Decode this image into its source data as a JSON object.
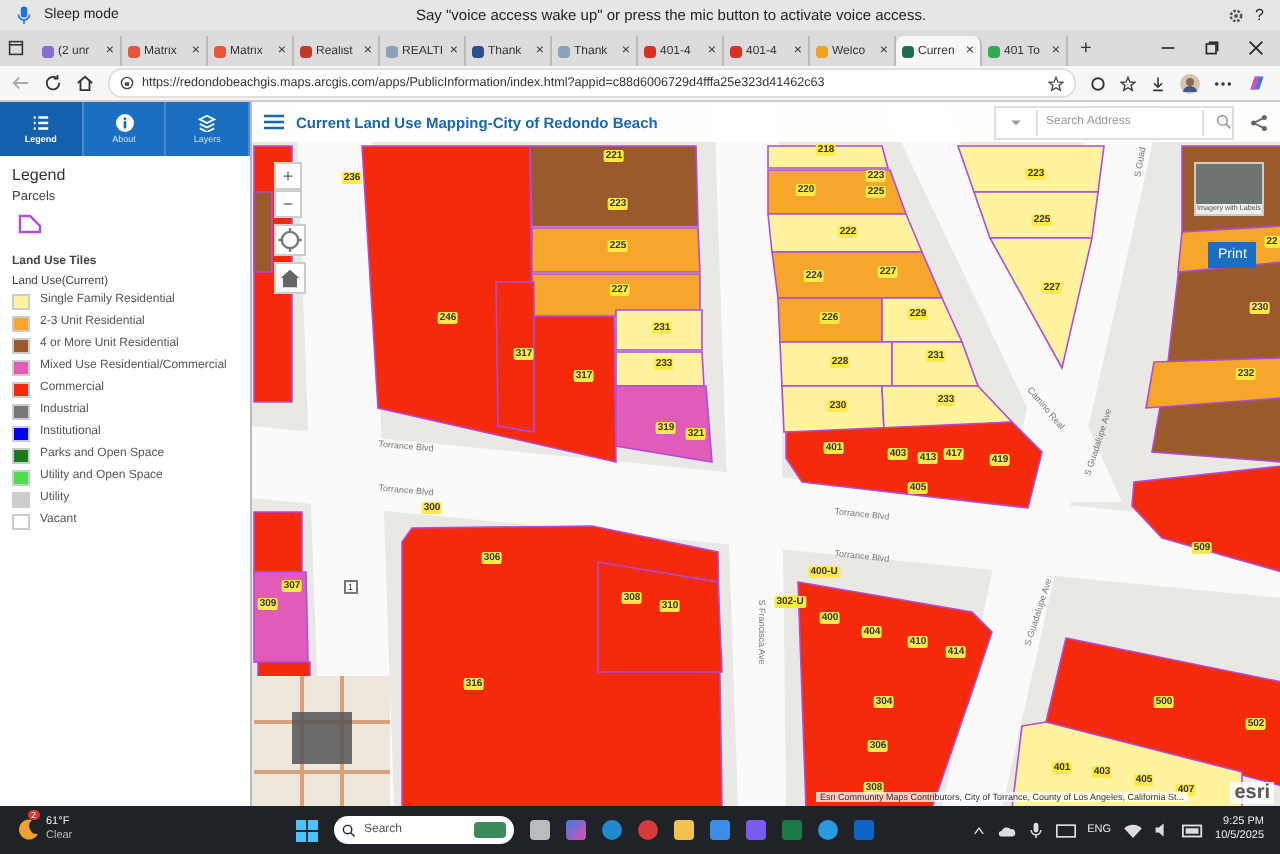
{
  "voice_bar": {
    "status": "Sleep mode",
    "message": "Say \"voice access wake up\" or press the mic button to activate voice access.",
    "help": "?"
  },
  "browser_tabs": [
    {
      "label": "(2 unr",
      "selected": false
    },
    {
      "label": "Matrix",
      "selected": false
    },
    {
      "label": "Matrix",
      "selected": false
    },
    {
      "label": "Realist",
      "selected": false
    },
    {
      "label": "REALTI",
      "selected": false
    },
    {
      "label": "Thank",
      "selected": false
    },
    {
      "label": "Thank",
      "selected": false
    },
    {
      "label": "401-4",
      "selected": false
    },
    {
      "label": "401-4",
      "selected": false
    },
    {
      "label": "Welco",
      "selected": false
    },
    {
      "label": "Curren",
      "selected": true
    },
    {
      "label": "401 To",
      "selected": false
    }
  ],
  "tab_close": "×",
  "new_tab": "+",
  "address": {
    "url": "https://redondobeachgis.maps.arcgis.com/apps/PublicInformation/index.html?appid=c88d6006729d4fffa25e323d41462c63"
  },
  "panel_tabs": [
    {
      "label": "Legend",
      "selected": true
    },
    {
      "label": "About",
      "selected": false
    },
    {
      "label": "Layers",
      "selected": false
    }
  ],
  "legend": {
    "title": "Legend",
    "parcels_heading": "Parcels",
    "layer_title": "Land Use Tiles",
    "field": "Land Use(Current)",
    "items": [
      {
        "label": "Single Family Residential",
        "color": "#fff3a0"
      },
      {
        "label": "2-3 Unit Residential",
        "color": "#f5a62b"
      },
      {
        "label": "4 or More Unit Residential",
        "color": "#9b5a2c"
      },
      {
        "label": "Mixed Use Residential/Commercial",
        "color": "#e05cb8"
      },
      {
        "label": "Commercial",
        "color": "#f52a0a"
      },
      {
        "label": "Industrial",
        "color": "#777777"
      },
      {
        "label": "Institutional",
        "color": "#0000ee"
      },
      {
        "label": "Parks and Open Space",
        "color": "#1f7a1f"
      },
      {
        "label": "Utility and Open Space",
        "color": "#4ce04c"
      },
      {
        "label": "Utility",
        "color": "#cccccc"
      },
      {
        "label": "Vacant",
        "color": "#ffffff"
      }
    ]
  },
  "app_title": "Current Land Use Mapping-City of Redondo Beach",
  "search": {
    "placeholder": "Search Address"
  },
  "map": {
    "zoom_in": "+",
    "zoom_out": "−",
    "streets": [
      "Torrance Blvd",
      "Torrance Blvd",
      "Torrance Blvd",
      "Torrance Blvd",
      "S Francisca Ave",
      "S Guadalupe Ave",
      "Camino Real",
      "S Guadalupe Ave",
      "S Guad"
    ],
    "route_shield": "1",
    "parcel_labels": [
      "236",
      "221",
      "223",
      "225",
      "227",
      "246",
      "317",
      "317",
      "231",
      "233",
      "319",
      "321",
      "218",
      "220",
      "223",
      "225",
      "222",
      "224",
      "227",
      "226",
      "229",
      "228",
      "231",
      "230",
      "233",
      "401",
      "403",
      "413",
      "417",
      "419",
      "405",
      "223",
      "225",
      "227",
      "22",
      "230",
      "232",
      "509",
      "307",
      "309",
      "300",
      "306",
      "316",
      "308",
      "310",
      "400-U",
      "302-U",
      "400",
      "404",
      "410",
      "414",
      "304",
      "306",
      "308",
      "500",
      "502",
      "401",
      "403",
      "405",
      "407"
    ],
    "basemap_label": "Imagery with Labels",
    "print": "Print",
    "attribution": "Esri Community Maps Contributors, City of Torrance, County of Los Angeles, California St...",
    "logo": "esri"
  },
  "taskbar": {
    "temperature": "61°F",
    "weather": "Clear",
    "weather_badge": "2",
    "search_placeholder": "Search",
    "language": "ENG",
    "time": "9:25 PM",
    "date": "10/5/2025"
  }
}
